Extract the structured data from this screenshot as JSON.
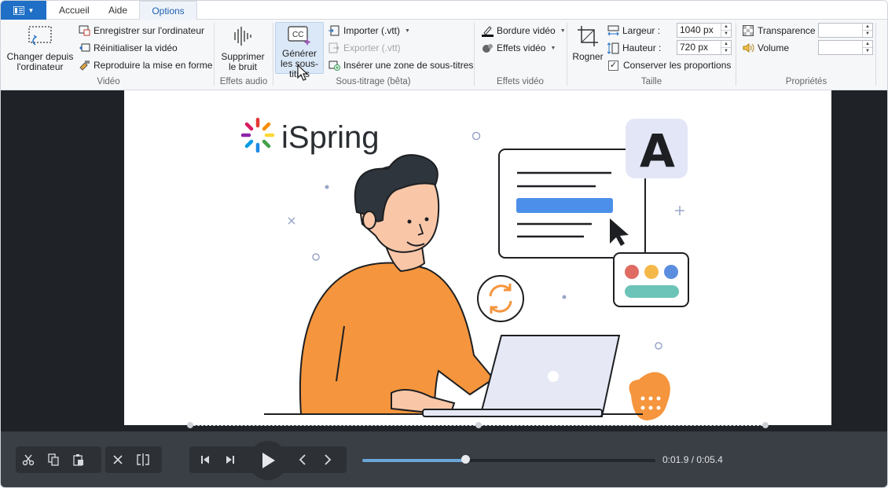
{
  "tabs": [
    {
      "label": "Accueil"
    },
    {
      "label": "Aide"
    },
    {
      "label": "Options"
    }
  ],
  "ribbon": {
    "video": {
      "label": "Vidéo",
      "change_label": "Changer depuis l'ordinateur",
      "save_label": "Enregistrer sur l'ordinateur",
      "reset_label": "Réinitialiser la vidéo",
      "format_label": "Reproduire la mise en forme"
    },
    "audio": {
      "label": "Effets audio",
      "denoise_label": "Supprimer le bruit"
    },
    "subtitles": {
      "label": "Sous-titrage (bêta)",
      "generate_label": "Générer les sous-titres",
      "import_label": "Importer (.vtt)",
      "export_label": "Exporter (.vtt)",
      "insert_label": "Insérer une zone de sous-titres"
    },
    "effects": {
      "label": "Effets vidéo",
      "border_label": "Bordure vidéo",
      "effects_label": "Effets vidéo"
    },
    "crop": {
      "label": "Rogner"
    },
    "size": {
      "label": "Taille",
      "width_label": "Largeur :",
      "width_value": "1040 px",
      "height_label": "Hauteur :",
      "height_value": "720 px",
      "keep_ratio_label": "Conserver les proportions",
      "keep_ratio": true
    },
    "properties": {
      "label": "Propriétés",
      "transparency_label": "Transparence :",
      "transparency_value": "",
      "volume_label": "Volume",
      "volume_value": ""
    }
  },
  "canvas": {
    "logo_text": "iSpring",
    "badge_letter": "A"
  },
  "player": {
    "progress_fraction": 0.3519,
    "time_current": "0:01.9",
    "time_total": "0:05.4",
    "time_sep": " / "
  },
  "colors": {
    "accent": "#1e6fc5",
    "shirt": "#f5953d",
    "stage_bg": "#1f2226",
    "player_bg": "#3a3f45",
    "progress": "#6aa7d8"
  }
}
